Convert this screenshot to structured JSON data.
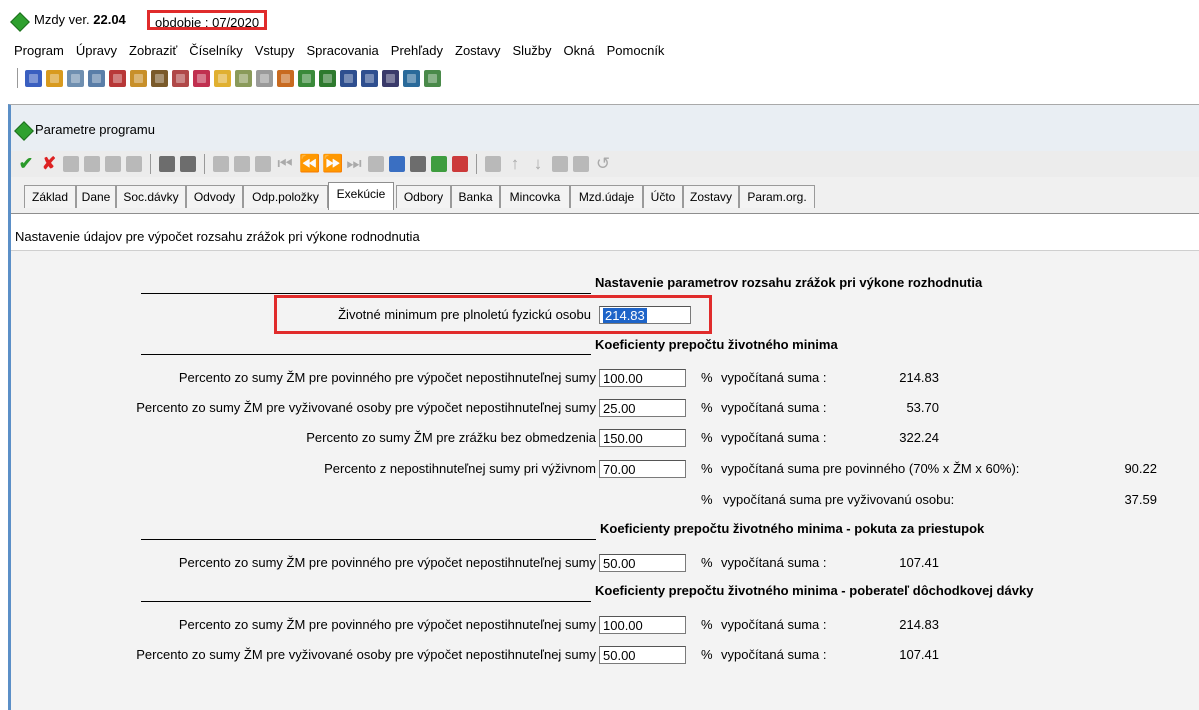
{
  "app": {
    "name": "Mzdy ver. ",
    "version": "22.04",
    "period": "obdobie : 07/2020"
  },
  "menu": [
    "Program",
    "Úpravy",
    "Zobraziť",
    "Číselníky",
    "Vstupy",
    "Spracovania",
    "Prehľady",
    "Zostavy",
    "Služby",
    "Okná",
    "Pomocník"
  ],
  "window": {
    "title": "Parametre programu",
    "subheader": "Nastavenie údajov pre výpočet rozsahu zrážok pri výkone rodnodnutia"
  },
  "tabs": [
    "Základ",
    "Dane",
    "Soc.dávky",
    "Odvody",
    "Odp.položky",
    "Exekúcie",
    "Odbory",
    "Banka",
    "Mincovka",
    "Mzd.údaje",
    "Účto",
    "Zostavy",
    "Param.org."
  ],
  "active_tab": "Exekúcie",
  "form": {
    "section1": "Nastavenie parametrov rozsahu zrážok pri výkone rozhodnutia",
    "zm_label": "Životné minimum pre plnoletú fyzickú osobu",
    "zm_value": "214.83",
    "section2": "Koeficienty prepočtu životného minima",
    "rows2": [
      {
        "label": "Percento zo sumy ŽM pre  povinného pre výpočet nepostihnuteľnej sumy",
        "value": "100.00",
        "pct": "%",
        "calc": "vypočítaná suma :",
        "result": "214.83"
      },
      {
        "label": "Percento zo sumy ŽM pre  vyživované osoby pre výpočet nepostihnuteľnej sumy",
        "value": "25.00",
        "pct": "%",
        "calc": "vypočítaná suma :",
        "result": "53.70"
      },
      {
        "label": "Percento zo sumy ŽM pre zrážku bez obmedzenia",
        "value": "150.00",
        "pct": "%",
        "calc": "vypočítaná suma :",
        "result": "322.24"
      },
      {
        "label": "Percento z nepostihnuteľnej sumy pri výživnom",
        "value": "70.00",
        "pct": "%",
        "calc": "vypočítaná suma pre povinného (70% x ŽM x 60%):",
        "result": "90.22"
      }
    ],
    "extra_row": {
      "pct": "%",
      "calc": "vypočítaná suma pre vyživovanú osobu:",
      "result": "37.59"
    },
    "section3": "Koeficienty prepočtu životného minima - pokuta za priestupok",
    "rows3": [
      {
        "label": "Percento zo sumy ŽM pre povinného pre výpočet nepostihnuteľnej sumy",
        "value": "50.00",
        "pct": "%",
        "calc": "vypočítaná suma :",
        "result": "107.41"
      }
    ],
    "section4": "Koeficienty prepočtu životného minima - poberateľ dôchodkovej dávky",
    "rows4": [
      {
        "label": "Percento zo sumy ŽM pre povinného pre výpočet nepostihnuteľnej sumy",
        "value": "100.00",
        "pct": "%",
        "calc": "vypočítaná suma :",
        "result": "214.83"
      },
      {
        "label": "Percento zo sumy ŽM pre vyživované osoby pre výpočet nepostihnuteľnej sumy",
        "value": "50.00",
        "pct": "%",
        "calc": "vypočítaná suma :",
        "result": "107.41"
      }
    ]
  },
  "colors": {
    "highlight": "#e02b2b",
    "accent": "#2fa12f",
    "selection": "#1e64c8"
  }
}
